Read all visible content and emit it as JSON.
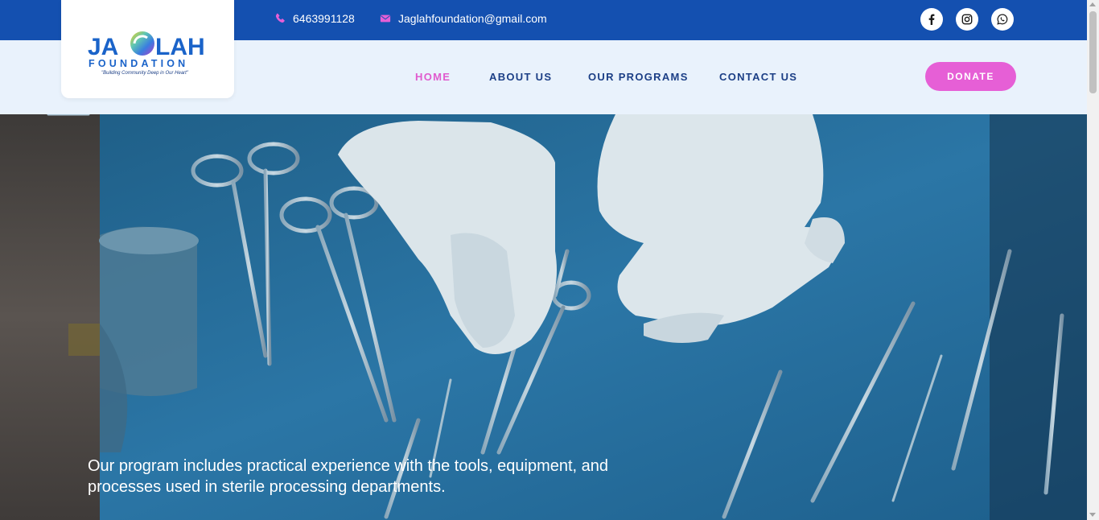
{
  "topbar": {
    "phone": "6463991128",
    "email": "Jaglahfoundation@gmail.com",
    "phone_icon": "phone-icon",
    "email_icon": "envelope-icon",
    "social": [
      {
        "name": "facebook",
        "icon": "facebook-icon"
      },
      {
        "name": "instagram",
        "icon": "instagram-icon"
      },
      {
        "name": "whatsapp",
        "icon": "whatsapp-icon"
      }
    ]
  },
  "logo": {
    "word_top_left": "JA",
    "word_top_right": "LAH",
    "word_bottom": "FOUNDATION",
    "tagline": "\"Building Community Deep in Our Heart\""
  },
  "nav": {
    "items": [
      {
        "label": "HOME",
        "active": true
      },
      {
        "label": "ABOUT US",
        "active": false
      },
      {
        "label": "OUR PROGRAMS",
        "active": false
      },
      {
        "label": "CONTACT US",
        "active": false
      }
    ],
    "donate_label": "DONATE"
  },
  "hero": {
    "text": "Our program includes practical experience with the tools, equipment, and processes used in sterile processing departments."
  },
  "colors": {
    "topbar": "#1450b0",
    "nav_bg": "#e9f2fc",
    "nav_text": "#1c3f86",
    "accent_pink": "#e65fd6",
    "hero_blue": "#2a6a92"
  }
}
